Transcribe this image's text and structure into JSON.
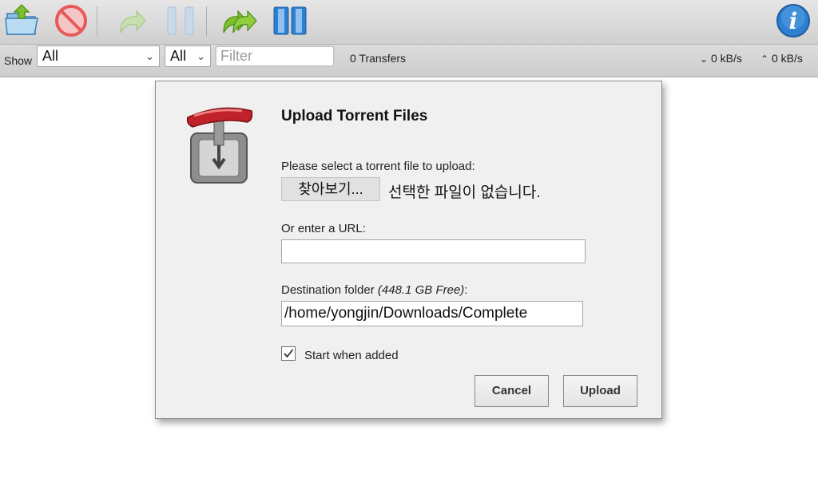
{
  "toolbar": {
    "buttons": [
      {
        "name": "open-torrent",
        "icon": "folder-upload-icon"
      },
      {
        "name": "remove-torrent",
        "icon": "remove-icon"
      },
      {
        "name": "resume-torrent",
        "icon": "resume-arrow-icon"
      },
      {
        "name": "pause-torrent",
        "icon": "pause-icon"
      },
      {
        "name": "resume-all",
        "icon": "resume-all-icon"
      },
      {
        "name": "pause-all",
        "icon": "pause-all-icon"
      },
      {
        "name": "about",
        "icon": "info-icon"
      }
    ]
  },
  "filterbar": {
    "show_label": "Show",
    "status_filter": "All",
    "tracker_filter": "All",
    "filter_placeholder": "Filter",
    "transfers": "0 Transfers",
    "download_speed": "0 kB/s",
    "upload_speed": "0 kB/s"
  },
  "dialog": {
    "title": "Upload Torrent Files",
    "select_label": "Please select a torrent file to upload:",
    "browse_button": "찾아보기...",
    "no_file_text": "선택한 파일이 없습니다.",
    "url_label": "Or enter a URL:",
    "url_value": "",
    "destination_label": "Destination folder ",
    "destination_free": "(448.1 GB Free)",
    "destination_colon": ":",
    "destination_value": "/home/yongjin/Downloads/Complete",
    "start_when_added": true,
    "start_when_added_label": "Start when added",
    "cancel_button": "Cancel",
    "upload_button": "Upload"
  },
  "colors": {
    "accent_green": "#7cbf2f",
    "remove_red": "#e8595b",
    "info_blue": "#2d7fd1",
    "logo_red": "#c0222a"
  }
}
